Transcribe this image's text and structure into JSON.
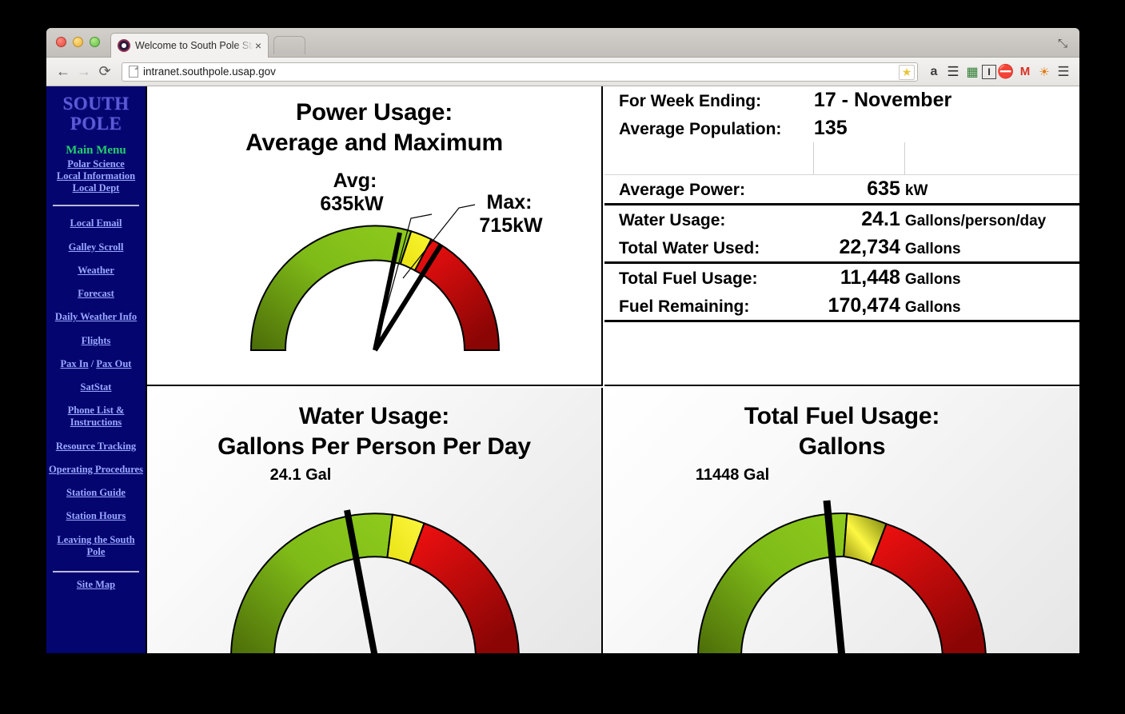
{
  "browser": {
    "tab_title": "Welcome to South Pole Static",
    "tab_close_label": "×",
    "url": "intranet.southpole.usap.gov",
    "back_icon": "←",
    "forward_icon": "→",
    "reload_icon": "⟳",
    "fullscreen_icon": "⤡",
    "star_icon": "★",
    "menu_icon": "☰",
    "extensions": [
      {
        "name": "amazon-extension-icon",
        "glyph": "a"
      },
      {
        "name": "layers-extension-icon",
        "glyph": "≣"
      },
      {
        "name": "screen-extension-icon",
        "glyph": "▣"
      },
      {
        "name": "info-extension-icon",
        "glyph": "I"
      },
      {
        "name": "adblock-extension-icon",
        "glyph": "✋"
      },
      {
        "name": "gmail-extension-icon",
        "glyph": "M"
      },
      {
        "name": "flame-extension-icon",
        "glyph": "◉"
      }
    ]
  },
  "sidebar": {
    "logo_line1": "SOUTH",
    "logo_line2": "POLE",
    "main_menu": "Main Menu",
    "top_links": [
      {
        "label": "Polar Science"
      },
      {
        "label": "Local Information"
      },
      {
        "label": "Local Dept"
      }
    ],
    "links": [
      {
        "label": "Local Email"
      },
      {
        "label": "Galley Scroll"
      },
      {
        "label": "Weather"
      },
      {
        "label": "Forecast"
      },
      {
        "label": "Daily Weather Info"
      },
      {
        "label": "Flights"
      }
    ],
    "pax_in": "Pax In",
    "pax_sep": " / ",
    "pax_out": "Pax Out",
    "links2": [
      {
        "label": "SatStat"
      },
      {
        "label": "Phone List & Instructions"
      },
      {
        "label": "Resource Tracking"
      },
      {
        "label": "Operating Procedures"
      },
      {
        "label": "Station Guide"
      },
      {
        "label": "Station Hours"
      },
      {
        "label": "Leaving the South Pole"
      }
    ],
    "site_map": "Site Map"
  },
  "stats": {
    "week_ending_label": "For Week Ending:",
    "week_ending_value": "17 - November",
    "population_label": "Average Population:",
    "population_value": "135",
    "rows": [
      {
        "label": "Average Power:",
        "value": "635",
        "unit": "kW"
      },
      {
        "label": "Water Usage:",
        "value": "24.1",
        "unit": "Gallons/person/day"
      },
      {
        "label": "Total Water Used:",
        "value": "22,734",
        "unit": "Gallons"
      },
      {
        "label": "Total Fuel Usage:",
        "value": "11,448",
        "unit": "Gallons"
      },
      {
        "label": "Fuel Remaining:",
        "value": "170,474",
        "unit": "Gallons"
      }
    ]
  },
  "chart_data": [
    {
      "type": "gauge",
      "id": "power-gauge",
      "title_line1": "Power Usage:",
      "title_line2": "Average and Maximum",
      "unit": "kW",
      "needles": [
        {
          "name": "Avg",
          "label_line1": "Avg:",
          "label_line2": "635kW",
          "value": 635,
          "angle_deg": 12
        },
        {
          "name": "Max",
          "label_line1": "Max:",
          "label_line2": "715kW",
          "value": 715,
          "angle_deg": 32
        }
      ],
      "bands": [
        {
          "color": "#7ab317",
          "from_deg": -90,
          "to_deg": 17
        },
        {
          "color": "#f2ec18",
          "from_deg": 17,
          "to_deg": 27
        },
        {
          "color": "#ee1111",
          "from_deg": 27,
          "to_deg": 90
        }
      ]
    },
    {
      "type": "gauge",
      "id": "water-gauge",
      "title_line1": "Water Usage:",
      "title_line2": "Gallons Per Person Per Day",
      "value_label": "24.1 Gal",
      "value": 24.1,
      "needle_angle_deg": -11,
      "bands": [
        {
          "color": "#7ab317",
          "from_deg": -90,
          "to_deg": 7
        },
        {
          "color": "#f2ec18",
          "from_deg": 7,
          "to_deg": 20
        },
        {
          "color": "#ee1111",
          "from_deg": 20,
          "to_deg": 90
        }
      ]
    },
    {
      "type": "gauge",
      "id": "fuel-gauge",
      "title_line1": "Total Fuel Usage:",
      "title_line2": "Gallons",
      "value_label": "11448 Gal",
      "value": 11448,
      "needle_angle_deg": -3,
      "bands": [
        {
          "color": "#7ab317",
          "from_deg": -90,
          "to_deg": 2
        },
        {
          "color": "#f2ec18",
          "from_deg": 2,
          "to_deg": 18
        },
        {
          "color": "#ee1111",
          "from_deg": 18,
          "to_deg": 90
        }
      ]
    }
  ],
  "colors": {
    "sidebar_bg": "#050570",
    "logo": "#5b5bd6",
    "menu_green": "#21d06a",
    "link": "#9aa8ff",
    "band_green": "#7ab317",
    "band_yellow": "#f2ec18",
    "band_red": "#ee1111"
  }
}
